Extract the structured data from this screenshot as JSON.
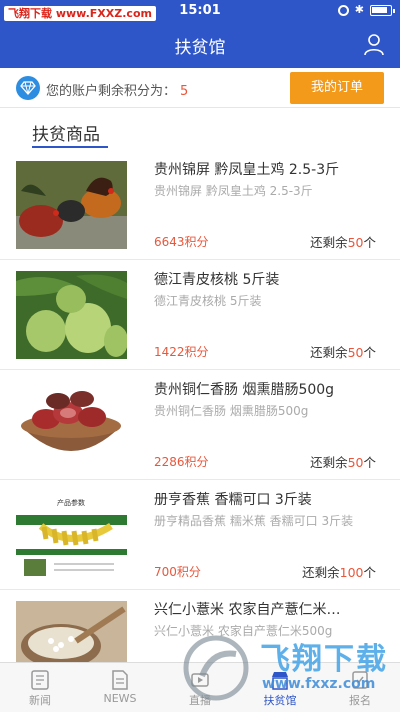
{
  "status": {
    "watermark_badge": "飞翔下载 www.FXXZ.com",
    "time": "15:01"
  },
  "header": {
    "title": "扶贫馆",
    "user_icon": "user-icon"
  },
  "points": {
    "label": "您的账户剩余积分为：",
    "value": "5",
    "icon": "diamond-icon",
    "orders_button": "我的订单",
    "colors": {
      "accent": "#f39a1a",
      "highlight": "#e8573b",
      "brand": "#2f56c9"
    }
  },
  "section": {
    "title": "扶贫商品"
  },
  "products": [
    {
      "name": "贵州锦屏 黔凤皇土鸡 2.5-3斤",
      "desc": "贵州锦屏 黔凤皇土鸡 2.5-3斤",
      "price": "6643积分",
      "stock_prefix": "还剩余",
      "stock_num": "50",
      "stock_suffix": "个",
      "image": "roosters"
    },
    {
      "name": "德江青皮核桃 5斤装",
      "desc": "德江青皮核桃 5斤装",
      "price": "1422积分",
      "stock_prefix": "还剩余",
      "stock_num": "50",
      "stock_suffix": "个",
      "image": "walnuts"
    },
    {
      "name": "贵州铜仁香肠 烟熏腊肠500g",
      "desc": "贵州铜仁香肠 烟熏腊肠500g",
      "price": "2286积分",
      "stock_prefix": "还剩余",
      "stock_num": "50",
      "stock_suffix": "个",
      "image": "sausage"
    },
    {
      "name": "册亨香蕉  香糯可口 3斤装",
      "desc": "册亨精品香蕉 糯米蕉 香糯可口 3斤装",
      "price": "700积分",
      "stock_prefix": "还剩余",
      "stock_num": "100",
      "stock_suffix": "个",
      "image": "bananas",
      "package_text": "产品参数"
    },
    {
      "name": "兴仁小薏米 农家自产薏仁米…",
      "desc": "兴仁小薏米 农家自产薏仁米500g",
      "price": "",
      "stock_prefix": "",
      "stock_num": "",
      "stock_suffix": "",
      "image": "barley"
    }
  ],
  "tabs": [
    {
      "label": "新闻",
      "icon": "news-icon",
      "active": false
    },
    {
      "label": "NEWS",
      "icon": "document-icon",
      "active": false
    },
    {
      "label": "直播",
      "icon": "live-icon",
      "active": false
    },
    {
      "label": "扶贫馆",
      "icon": "store-icon",
      "active": true
    },
    {
      "label": "报名",
      "icon": "signup-icon",
      "active": false
    }
  ],
  "watermark": {
    "cn": "飞翔下载",
    "url": "www.fxxz.com"
  }
}
